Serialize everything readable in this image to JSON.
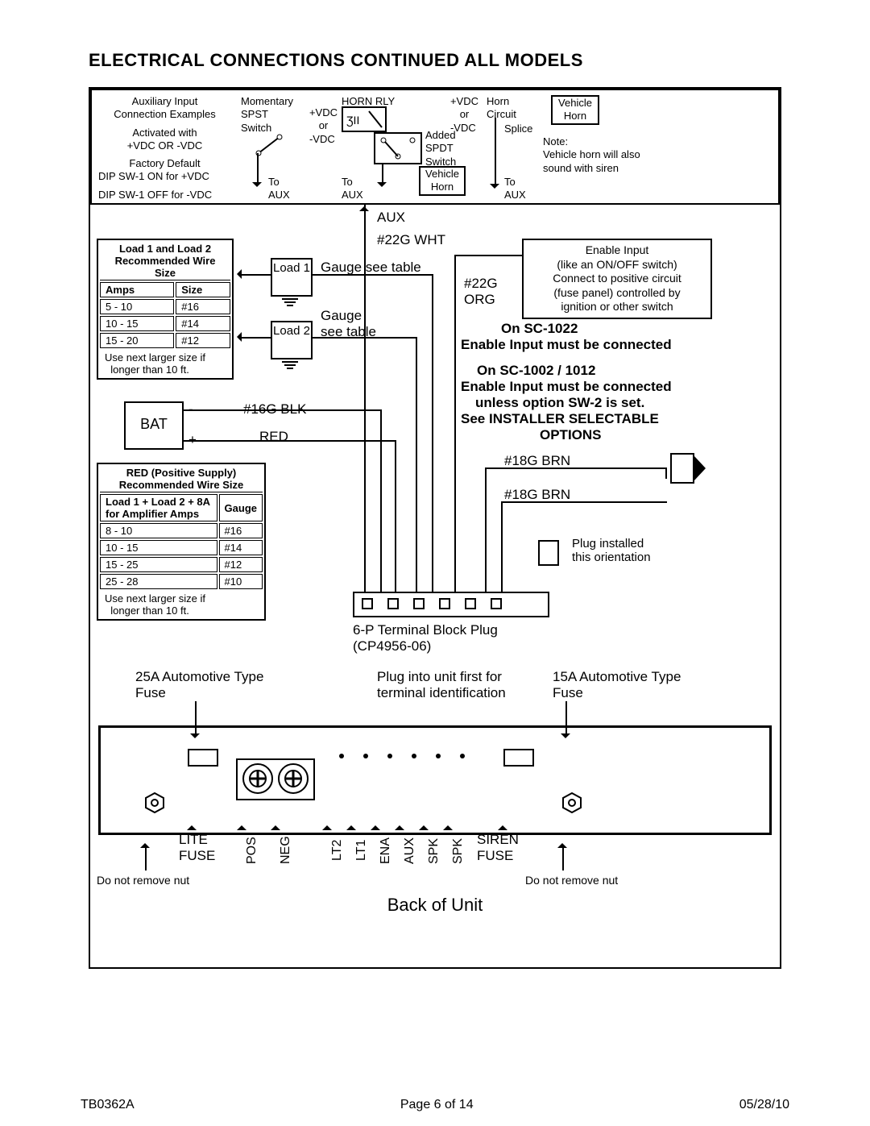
{
  "header": {
    "title": "ELECTRICAL CONNECTIONS CONTINUED   ALL MODELS"
  },
  "aux_examples": {
    "col1": {
      "l1": "Auxiliary Input",
      "l2": "Connection Examples",
      "l3": "Activated with",
      "l4": "+VDC  OR  -VDC",
      "l5": "Factory Default",
      "l6": "DIP SW-1 ON for +VDC",
      "l7": "DIP SW-1 OFF for -VDC"
    },
    "col2": {
      "l1": "Momentary",
      "l2": "SPST",
      "l3": "Switch",
      "l4": "+VDC",
      "l5": "or",
      "l6": "-VDC",
      "l7": "To",
      "l8": "AUX"
    },
    "col3": {
      "l1": "HORN RLY",
      "l2": "+VDC",
      "l3": "or",
      "l4": "-VDC",
      "l5": "Added",
      "l6": "SPDT",
      "l7": "Switch",
      "l8": "Vehicle",
      "l9": "Horn",
      "l10": "To",
      "l11": "AUX"
    },
    "col4": {
      "l1": "Horn",
      "l2": "Circuit",
      "l3": "Vehicle",
      "l4": "Horn",
      "l5": "Splice",
      "l6": "Note:",
      "l7": "Vehicle horn will also",
      "l8": "sound with siren",
      "l9": "To",
      "l10": "AUX"
    }
  },
  "labels": {
    "aux": "AUX",
    "aux_wire": "#22G WHT",
    "load1": "Load 1",
    "load2": "Load 2",
    "gauge1": "Gauge see table",
    "gauge2": "Gauge see table",
    "org1": "#22G",
    "org2": "ORG",
    "bat": "BAT",
    "bat_neg": "-",
    "bat_pos": "+",
    "blk": "#16G BLK",
    "red": "RED",
    "brn1": "#18G BRN",
    "brn2": "#18G BRN",
    "plug_name": "6-P Terminal Block Plug",
    "plug_pn": "(CP4956-06)",
    "plug_note1": "Plug into unit first for",
    "plug_note2": "terminal identification",
    "plug_orient1": "Plug installed",
    "plug_orient2": "this orientation",
    "fuse25": "25A Automotive Type Fuse",
    "fuse15": "15A Automotive Type Fuse",
    "lite_fuse": "LITE FUSE",
    "siren_fuse": "SIREN FUSE",
    "back": "Back of Unit",
    "nut1": "Do not remove nut",
    "nut2": "Do not remove nut"
  },
  "enable_box": {
    "l1": "Enable Input",
    "l2": "(like an ON/OFF switch)",
    "l3": "Connect to positive circuit",
    "l4": "(fuse panel) controlled by",
    "l5": "ignition or other switch"
  },
  "enable_notes": {
    "n1": "On  SC-1022",
    "n2": "Enable Input must be connected",
    "n3": "On  SC-1002 / 1012",
    "n4": "Enable Input must be connected",
    "n5": "unless option SW-2 is set.",
    "n6": "See INSTALLER SELECTABLE",
    "n7": "OPTIONS"
  },
  "terminals": [
    "POS",
    "NEG",
    "LT2",
    "LT1",
    "ENA",
    "AUX",
    "SPK",
    "SPK"
  ],
  "load_table": {
    "title1": "Load 1  and  Load 2",
    "title2": "Recommended Wire Size",
    "h1": "Amps",
    "h2": "Size",
    "rows": [
      [
        "5 - 10",
        "#16"
      ],
      [
        "10 - 15",
        "#14"
      ],
      [
        "15 - 20",
        "#12"
      ]
    ],
    "note1": "Use next larger size if",
    "note2": "longer than 10 ft."
  },
  "red_table": {
    "title1": "RED (Positive Supply)",
    "title2": "Recommended Wire Size",
    "h1": "Load 1 + Load 2 + 8A for Amplifier Amps",
    "h2": "Gauge",
    "rows": [
      [
        "8 - 10",
        "#16"
      ],
      [
        "10 - 15",
        "#14"
      ],
      [
        "15 - 25",
        "#12"
      ],
      [
        "25 - 28",
        "#10"
      ]
    ],
    "note1": "Use next larger size if",
    "note2": "longer than 10 ft."
  },
  "footer": {
    "left": "TB0362A",
    "center": "Page 6 of 14",
    "right": "05/28/10"
  }
}
